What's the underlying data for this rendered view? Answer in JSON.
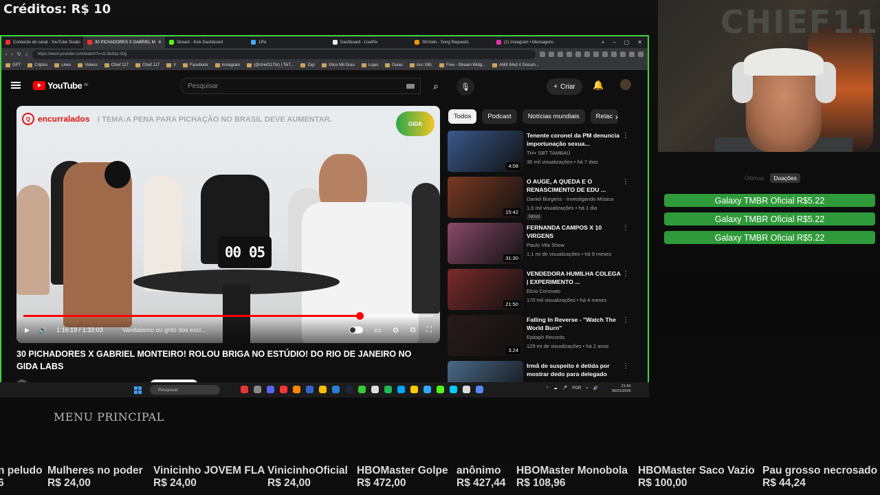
{
  "credits": "Créditos: R$ 10",
  "browser": {
    "tabs": [
      {
        "label": "Conteúdo do canal - YouTube Studio",
        "color": "#e33",
        "active": false
      },
      {
        "label": "30 PICHADORES X GABRIEL M",
        "color": "#e33",
        "active": true
      },
      {
        "label": "Stream - Kick Dashboard",
        "color": "#53fc18",
        "active": false
      },
      {
        "label": "1Pix",
        "color": "#4af",
        "active": false
      },
      {
        "label": "Dashboard - LivePix",
        "color": "#eee",
        "active": false
      },
      {
        "label": "SKVods - Song Requests",
        "color": "#e90",
        "active": false
      },
      {
        "label": "(1) Instagram • Mensagens",
        "color": "#d3a",
        "active": false
      }
    ],
    "url": "https://www.youtube.com/watch?v=zLSbSqz-rDg",
    "bookmarks": [
      "GPT",
      "Criptos",
      "Lives",
      "Videos",
      "Chief 117",
      "Chief 117",
      "X",
      "Facebook",
      "Instagram",
      "(@chief117br) | TikT...",
      "Zap",
      "Xbox Mil Grau",
      "Lojas",
      "Guias",
      "Acc XBL",
      "Free - Stream Widg...",
      "AMX Mod X Docum..."
    ]
  },
  "youtube": {
    "logo": "YouTube",
    "region": "BR",
    "search_placeholder": "Pesquisar",
    "create_label": "Criar",
    "player": {
      "brand": "encurralados",
      "topic": "I TEMA:A PENA PARA PICHAÇÃO NO BRASIL DEVE AUMENTAR.",
      "badge": "GIDA",
      "timer": "00 05",
      "time": "1:16:19 / 1:33:03",
      "chapter": "Vandalismo ou grito dos excl...",
      "progress": 0.82
    },
    "video_title": "30 PICHADORES X GABRIEL MONTEIRO! ROLOU BRIGA NO ESTÚDIO! DO RIO DE JANEIRO NO GIDA LABS",
    "chips": [
      "Todos",
      "Podcast",
      "Notícias mundiais",
      "Relac"
    ],
    "recommendations": [
      {
        "title": "Tenente coronel da PM denuncia importunação sexua...",
        "channel": "TH+ SBT TAMBAÚ",
        "stats": "35 mil visualizações • há 7 dias",
        "duration": "4:08",
        "thumb": "#3a5a8c",
        "badge": ""
      },
      {
        "title": "O AUGE, A QUEDA E O RENASCIMENTO DE EDU ...",
        "channel": "Daniel Borgens - Investigando Música",
        "stats": "1,5 mil visualizações • há 1 dia",
        "duration": "15:42",
        "thumb": "#7a3a22",
        "badge": "Novo"
      },
      {
        "title": "FERNANDA CAMPOS X 10 VIRGENS",
        "channel": "Paulo Vita Show",
        "stats": "1,1 mi de visualizações • há 9 meses",
        "duration": "31:30",
        "thumb": "#8a4a6a",
        "badge": ""
      },
      {
        "title": "VENDEDORA HUMILHA COLEGA | EXPERIMENTO ...",
        "channel": "Elcio Coronato",
        "stats": "170 mil visualizações • há 4 meses",
        "duration": "21:50",
        "thumb": "#7a2a2a",
        "badge": ""
      },
      {
        "title": "Falling In Reverse - \"Watch The World Burn\"",
        "channel": "Epitaph Records",
        "stats": "129 mi de visualizações • há 2 anos",
        "duration": "3:24",
        "thumb": "#2a1a1a",
        "badge": ""
      },
      {
        "title": "Irmã de suspeito é detida por mostrar dedo para delegado",
        "channel": "",
        "stats": "",
        "duration": "",
        "thumb": "#4a6a8a",
        "badge": ""
      }
    ]
  },
  "taskbar": {
    "search_placeholder": "Pesquisar",
    "lang": "POR",
    "time": "21:50",
    "date": "06/01/2026"
  },
  "webcam": {
    "brand_text": "CHIEF11"
  },
  "donations": {
    "tab_latest": "Últimas",
    "tab_donations": "Doações",
    "items": [
      "Galaxy TMBR Oficial  R$5.22",
      "Galaxy TMBR Oficial  R$5.22",
      "Galaxy TMBR Oficial  R$5.22"
    ]
  },
  "menu_principal": "MENU PRINCIPAL",
  "ticker": [
    {
      "name": "n peludo",
      "value": "6"
    },
    {
      "name": "Mulheres no poder",
      "value": "R$ 24,00"
    },
    {
      "name": "Vinicinho JOVEM FLA",
      "value": "R$ 24,00"
    },
    {
      "name": "VinicinhoOficial",
      "value": "R$ 24,00"
    },
    {
      "name": "HBOMaster Golpe",
      "value": "R$ 472,00"
    },
    {
      "name": "anônimo",
      "value": "R$ 427,44"
    },
    {
      "name": "HBOMaster Monobola",
      "value": "R$ 108,96"
    },
    {
      "name": "HBOMaster Saco Vazio",
      "value": "R$ 100,00"
    },
    {
      "name": "Pau grosso necrosado",
      "value": "R$ 44,24"
    }
  ]
}
